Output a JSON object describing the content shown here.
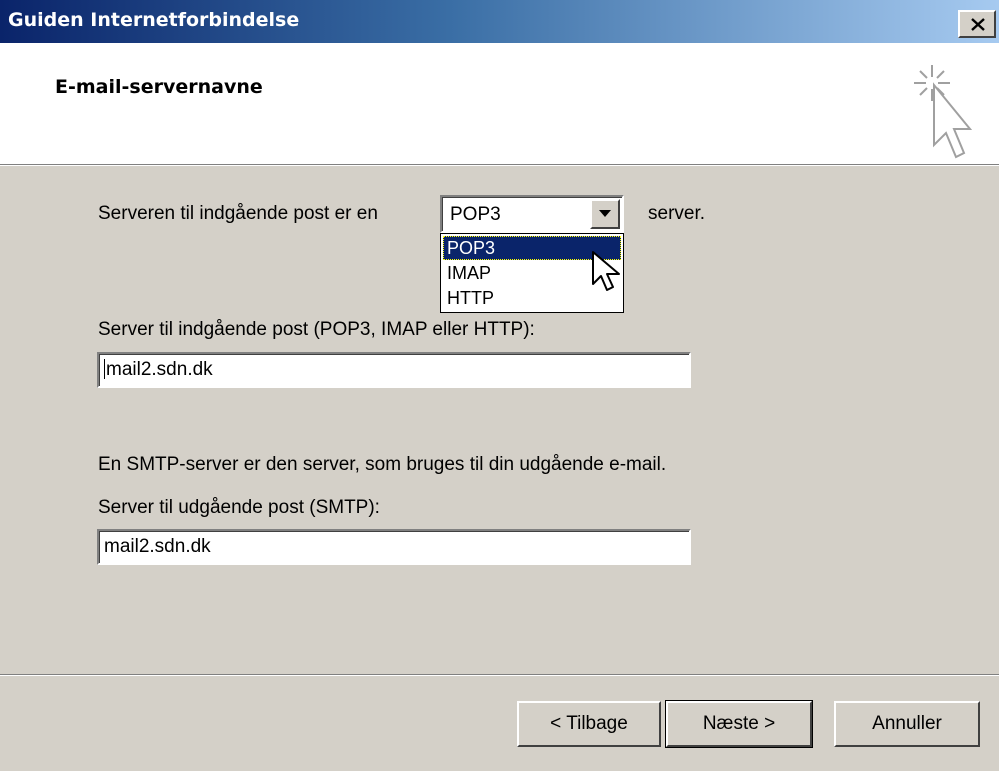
{
  "window": {
    "title": "Guiden Internetforbindelse"
  },
  "header": {
    "title": "E-mail-servernavne"
  },
  "incoming_type": {
    "label_before": "Serveren til indgående post er en",
    "selected": "POP3",
    "label_after": "server.",
    "options": [
      "POP3",
      "IMAP",
      "HTTP"
    ]
  },
  "incoming_server": {
    "label": "Server til indgående post (POP3, IMAP eller HTTP):",
    "value": "mail2.sdn.dk"
  },
  "smtp": {
    "info": "En SMTP-server er den server, som bruges til din udgående e-mail.",
    "label": "Server til udgående post (SMTP):",
    "value": "mail2.sdn.dk"
  },
  "buttons": {
    "back": "< Tilbage",
    "next": "Næste >",
    "cancel": "Annuller"
  },
  "colors": {
    "titlebar_start": "#0a246a",
    "titlebar_end": "#a6caf0",
    "dialog_face": "#d4d0c8",
    "selection": "#0a246a"
  },
  "icons": {
    "close": "close-icon",
    "wizard": "wizard-cursor-icon",
    "dropdown": "chevron-down-icon",
    "pointer": "mouse-pointer-icon"
  }
}
